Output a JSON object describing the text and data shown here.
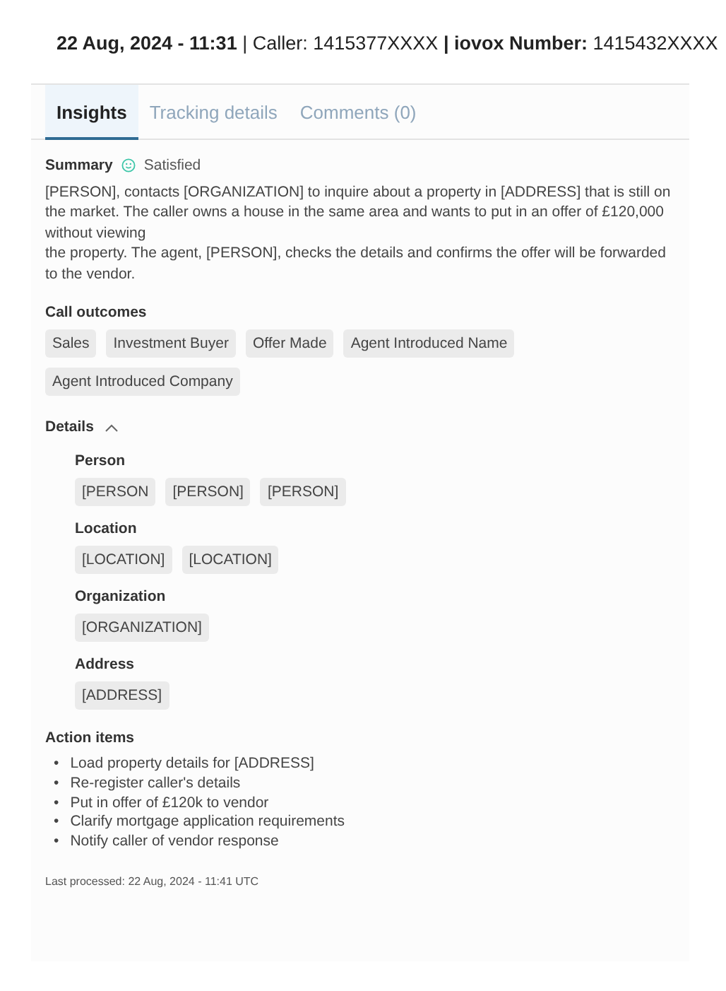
{
  "header": "**22 Aug, 2024 - 11:31** | Caller: 1415377XXXX   **| iovox Number:** 1415432XXXX",
  "tabs": [
    {
      "label": "Insights",
      "selected": true
    },
    {
      "label": "Tracking details",
      "selected": false
    },
    {
      "label": "Comments (0)",
      "selected": false
    }
  ],
  "summary": {
    "title": "Summary",
    "sentiment": "Satisfied",
    "text": "[PERSON], contacts [ORGANIZATION] to inquire about a property in [ADDRESS] that is still on the market. The caller owns a house in the same area and wants to put in an offer of £120,000 without viewing\nthe property. The agent, [PERSON], checks the details and confirms the offer will be forwarded to the vendor."
  },
  "call_outcomes": {
    "title": "Call outcomes",
    "tags": [
      "Sales",
      "Investment Buyer",
      "Offer Made",
      "Agent Introduced Name",
      "Agent Introduced Company"
    ]
  },
  "details": {
    "title": "Details",
    "expanded": true,
    "groups": [
      {
        "label": "Person",
        "tags": [
          "[PERSON",
          "[PERSON]",
          "[PERSON]"
        ]
      },
      {
        "label": "Location",
        "tags": [
          "[LOCATION]",
          "[LOCATION]"
        ]
      },
      {
        "label": "Organization",
        "tags": [
          "[ORGANIZATION]"
        ]
      },
      {
        "label": "Address",
        "tags": [
          "[ADDRESS]"
        ]
      }
    ]
  },
  "action_items": {
    "title": "Action items",
    "items": [
      {
        "marker": "•",
        "text": "Load property details for [ADDRESS]"
      },
      {
        "marker": "•",
        "text": "Re-register caller's details"
      },
      {
        "marker": "•",
        "text": "Put in offer of £120k to vendor"
      },
      {
        "marker": "•",
        "text": "Clarify mortgage application requirements"
      },
      {
        "marker": "•",
        "text": "Notify caller of vendor response"
      }
    ]
  },
  "footer": "Last processed: 22 Aug, 2024 - 11:41 UTC"
}
